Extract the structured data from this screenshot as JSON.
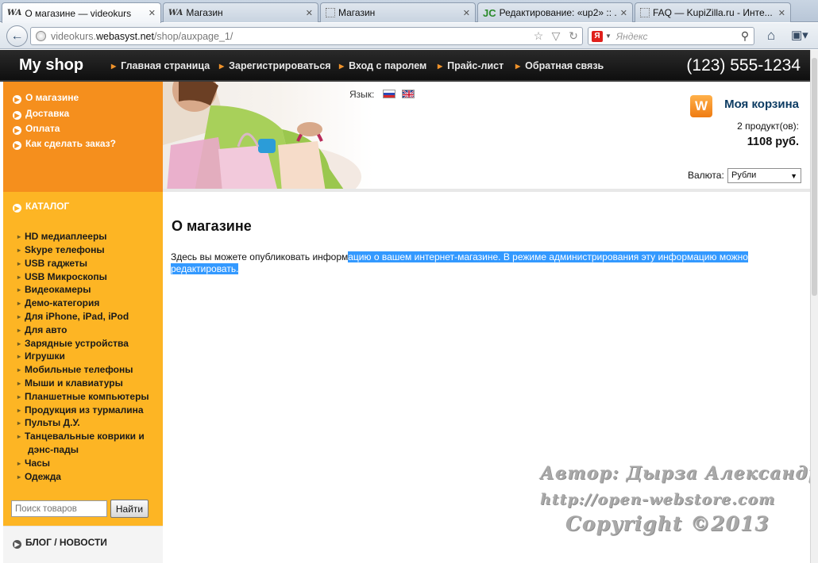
{
  "browser": {
    "tabs": [
      {
        "favicon": "WA",
        "label": "О магазине — videokurs",
        "close": "✕",
        "active": true
      },
      {
        "favicon": "WA",
        "label": "Магазин",
        "close": "✕",
        "active": false
      },
      {
        "favicon": "",
        "label": "Магазин",
        "close": "✕",
        "active": false
      },
      {
        "favicon": "JC",
        "label": "Редактирование: «up2» :: ...",
        "close": "✕",
        "active": false
      },
      {
        "favicon": "",
        "label": "FAQ — KupiZilla.ru - Инте...",
        "close": "✕",
        "active": false
      }
    ],
    "url_prefix": "videokurs.",
    "url_host": "webasyst.net",
    "url_path": "/shop/auxpage_1/",
    "search_engine_letter": "Я",
    "search_placeholder": "Яндекс"
  },
  "header": {
    "logo": "My shop",
    "nav": [
      "Главная страница",
      "Зарегистрироваться",
      "Вход с паролем",
      "Прайс-лист",
      "Обратная связь"
    ],
    "phone": "(123) 555-1234"
  },
  "info_links": [
    "О магазине",
    "Доставка",
    "Оплата",
    "Как сделать заказ?"
  ],
  "catalog": {
    "title": "КАТАЛОГ",
    "items": [
      "HD медиаплееры",
      "Skype телефоны",
      "USB гаджеты",
      "USB Микроскопы",
      "Видеокамеры",
      "Демо-категория",
      "Для iPhone, iPad, iPod",
      "Для авто",
      "Зарядные устройства",
      "Игрушки",
      "Мобильные телефоны",
      "Мыши и клавиатуры",
      "Планшетные компьютеры",
      "Продукция из турмалина",
      "Пульты Д.У.",
      "Танцевальные коврики и",
      "дэнс-пады",
      "Часы",
      "Одежда"
    ]
  },
  "product_search": {
    "placeholder": "Поиск товаров",
    "button": "Найти"
  },
  "blog": {
    "title": "БЛОГ / НОВОСТИ"
  },
  "banner": {
    "lang_label": "Язык:",
    "cart_title": "Моя корзина",
    "cart_count": "2 продукт(ов):",
    "cart_total": "1108 руб.",
    "currency_label": "Валюта:",
    "currency_value": "Рубли"
  },
  "content": {
    "title": "О магазине",
    "text_plain": "Здесь вы можете опубликовать информ",
    "text_selected": "ацию о вашем интернет-магазине. В режиме администрирования эту информацию можно редактировать."
  },
  "watermark": {
    "author": "Автор: Дырза Александр",
    "url": "http://open-webstore.com",
    "copyright": "Copyright ©2013"
  },
  "colors": {
    "orange": "#f58f1d",
    "yellow": "#fdb524",
    "header_dark": "#1a1a1a",
    "selection": "#3399ff"
  }
}
